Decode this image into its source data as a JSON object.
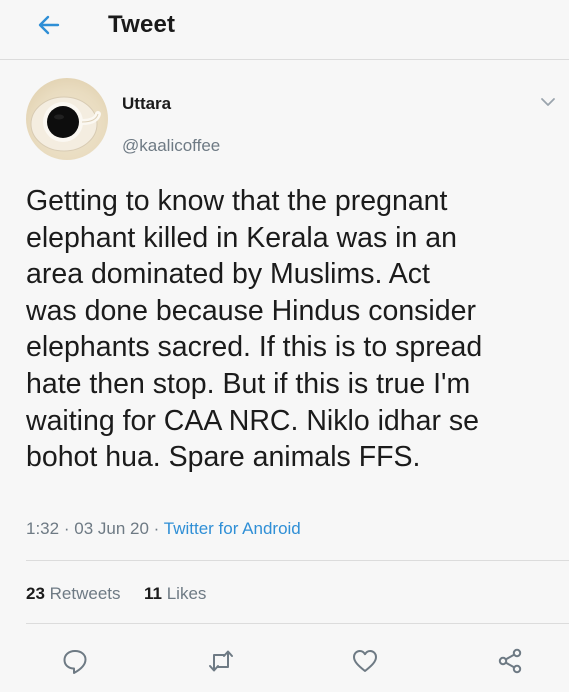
{
  "header": {
    "title": "Tweet",
    "back_icon": "arrow-left-icon",
    "accent_color": "#2f8fd6"
  },
  "author": {
    "name": "Uttara",
    "handle": "@kaalicoffee",
    "avatar_icon": "coffee-cup-avatar"
  },
  "tweet": {
    "text": "Getting to know that the pregnant\nelephant killed in Kerala was in an\narea dominated by Muslims. Act\nwas done because Hindus consider\nelephants sacred. If this is to spread\nhate then stop. But if this is true I'm\nwaiting for CAA NRC. Niklo idhar se\nbohot hua. Spare animals FFS.",
    "time": "1:32",
    "separator": "·",
    "date": "03 Jun 20",
    "source": "Twitter for Android"
  },
  "stats": {
    "retweets_count": "23",
    "retweets_label": "Retweets",
    "likes_count": "11",
    "likes_label": "Likes"
  },
  "actions": [
    {
      "name": "reply",
      "icon": "reply-bubble-icon"
    },
    {
      "name": "retweet",
      "icon": "retweet-icon"
    },
    {
      "name": "like",
      "icon": "heart-icon"
    },
    {
      "name": "share",
      "icon": "share-icon"
    }
  ],
  "colors": {
    "background": "#f7f7f7",
    "text": "#1b1b1b",
    "secondary": "#6e7a84",
    "link": "#2f8fd6",
    "divider": "#dcdcdc"
  }
}
